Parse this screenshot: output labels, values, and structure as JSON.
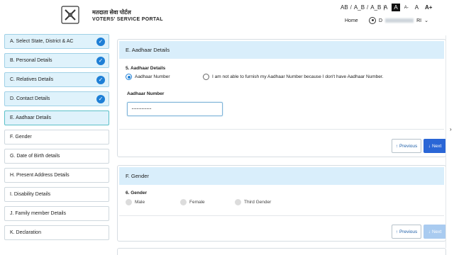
{
  "header": {
    "portal_name_hindi": "मतदाता सेवा पोर्टल",
    "portal_name": "VOTERS' SERVICE PORTAL",
    "lang_options": [
      "AB",
      "A_B",
      "A_B"
    ],
    "font_sizes": [
      "A",
      "A",
      "A-",
      "A",
      "A+"
    ],
    "home": "Home",
    "user_initial": "D",
    "user_suffix": "RI"
  },
  "sidebar": {
    "items": [
      {
        "label": "A. Select State, District & AC",
        "status": "done"
      },
      {
        "label": "B. Personal Details",
        "status": "done"
      },
      {
        "label": "C. Relatives Details",
        "status": "done"
      },
      {
        "label": "D. Contact Details",
        "status": "done"
      },
      {
        "label": "E. Aadhaar Details",
        "status": "current"
      },
      {
        "label": "F. Gender",
        "status": "pending"
      },
      {
        "label": "G. Date of Birth details",
        "status": "pending"
      },
      {
        "label": "H. Present Address Details",
        "status": "pending"
      },
      {
        "label": "I. Disability Details",
        "status": "pending"
      },
      {
        "label": "J. Family member Details",
        "status": "pending"
      },
      {
        "label": "K. Declaration",
        "status": "pending"
      }
    ],
    "check_glyph": "✓"
  },
  "aadhaar": {
    "title": "E. Aadhaar Details",
    "question": "5. Aadhaar Details",
    "option_number": "Aadhaar Number",
    "option_none": "I am not able to furnish my Aadhaar Number because I don't have Aadhaar Number.",
    "field_label": "Aadhaar Number",
    "field_value": "············",
    "prev": "Previous",
    "next": "Next"
  },
  "gender": {
    "title": "F. Gender",
    "question": "6. Gender",
    "options": [
      "Male",
      "Female",
      "Third Gender"
    ],
    "prev": "Previous",
    "next": "Next"
  },
  "icons": {
    "arrow_up": "↑",
    "arrow_down": "↓",
    "chevron": "⌄"
  },
  "colors": {
    "accent": "#2a66d6",
    "header_band": "#d9eefb",
    "check": "#1e7fd6"
  }
}
